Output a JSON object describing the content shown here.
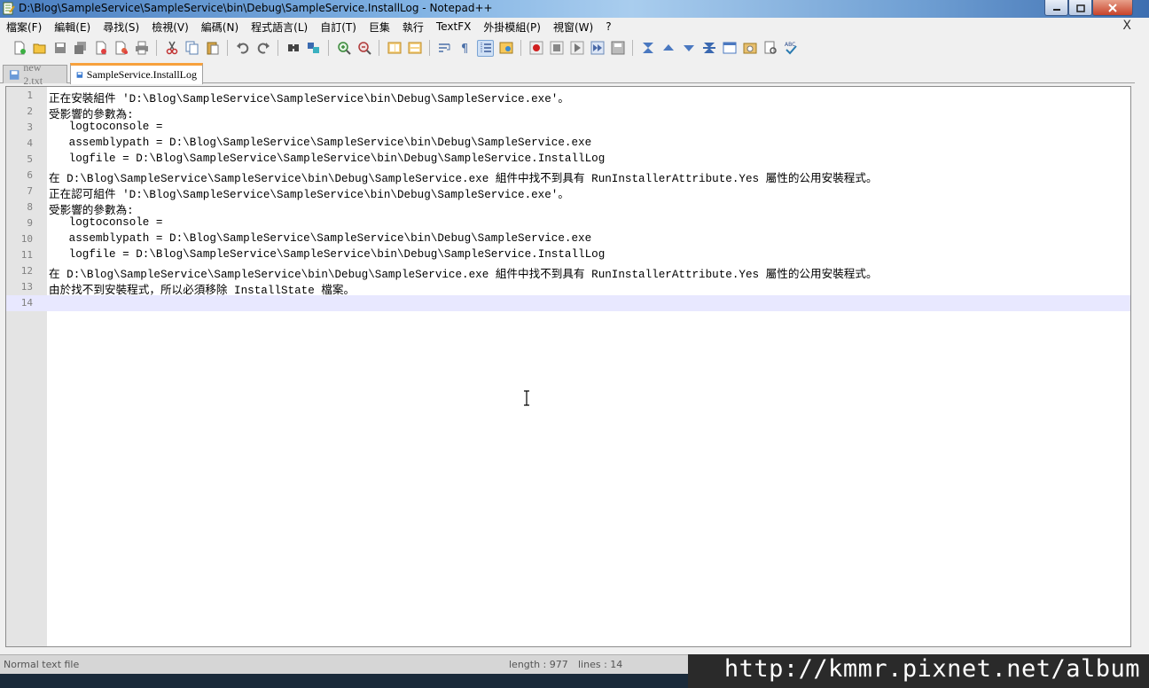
{
  "window": {
    "title": "D:\\Blog\\SampleService\\SampleService\\bin\\Debug\\SampleService.InstallLog - Notepad++"
  },
  "menu": {
    "items": [
      "檔案(F)",
      "編輯(E)",
      "尋找(S)",
      "檢視(V)",
      "編碼(N)",
      "程式語言(L)",
      "自訂(T)",
      "巨集",
      "執行",
      "TextFX",
      "外掛模組(P)",
      "視窗(W)",
      "?"
    ],
    "close": "X"
  },
  "tabs": [
    {
      "label": "new  2.txt",
      "active": false
    },
    {
      "label": "SampleService.InstallLog",
      "active": true
    }
  ],
  "editor": {
    "lines": [
      "正在安裝組件 'D:\\Blog\\SampleService\\SampleService\\bin\\Debug\\SampleService.exe'。",
      "受影響的參數為:",
      "   logtoconsole =",
      "   assemblypath = D:\\Blog\\SampleService\\SampleService\\bin\\Debug\\SampleService.exe",
      "   logfile = D:\\Blog\\SampleService\\SampleService\\bin\\Debug\\SampleService.InstallLog",
      "在 D:\\Blog\\SampleService\\SampleService\\bin\\Debug\\SampleService.exe 組件中找不到具有 RunInstallerAttribute.Yes 屬性的公用安裝程式。",
      "正在認可組件 'D:\\Blog\\SampleService\\SampleService\\bin\\Debug\\SampleService.exe'。",
      "受影響的參數為:",
      "   logtoconsole =",
      "   assemblypath = D:\\Blog\\SampleService\\SampleService\\bin\\Debug\\SampleService.exe",
      "   logfile = D:\\Blog\\SampleService\\SampleService\\bin\\Debug\\SampleService.InstallLog",
      "在 D:\\Blog\\SampleService\\SampleService\\bin\\Debug\\SampleService.exe 組件中找不到具有 RunInstallerAttribute.Yes 屬性的公用安裝程式。",
      "由於找不到安裝程式，所以必須移除 InstallState 檔案。",
      ""
    ],
    "line_numbers": [
      "1",
      "2",
      "3",
      "4",
      "5",
      "6",
      "7",
      "8",
      "9",
      "10",
      "11",
      "12",
      "13",
      "14"
    ],
    "current_line_index": 13
  },
  "status": {
    "type": "Normal text file",
    "length": "length : 977",
    "lines": "lines : 14"
  },
  "watermark": "http://kmmr.pixnet.net/album",
  "colors": {
    "current_line": "#e8e8ff",
    "gutter": "#e4e4e4",
    "active_tab_accent": "#f7a13d"
  },
  "toolbar_icons": [
    "new-file-icon",
    "open-file-icon",
    "save-icon",
    "save-all-icon",
    "close-icon",
    "close-all-icon",
    "print-icon",
    "cut-icon",
    "copy-icon",
    "paste-icon",
    "undo-icon",
    "redo-icon",
    "find-icon",
    "replace-icon",
    "zoom-in-icon",
    "zoom-out-icon",
    "sync-v-icon",
    "sync-h-icon",
    "word-wrap-icon",
    "show-all-chars-icon",
    "indent-guide-icon",
    "user-lang-icon",
    "record-macro-icon",
    "stop-macro-icon",
    "play-macro-icon",
    "run-macro-multiple-icon",
    "save-macro-icon",
    "textfx-1-icon",
    "textfx-2-icon",
    "textfx-3-icon",
    "textfx-4-icon",
    "textfx-5-icon",
    "textfx-6-icon",
    "textfx-7-icon",
    "spellcheck-icon"
  ]
}
